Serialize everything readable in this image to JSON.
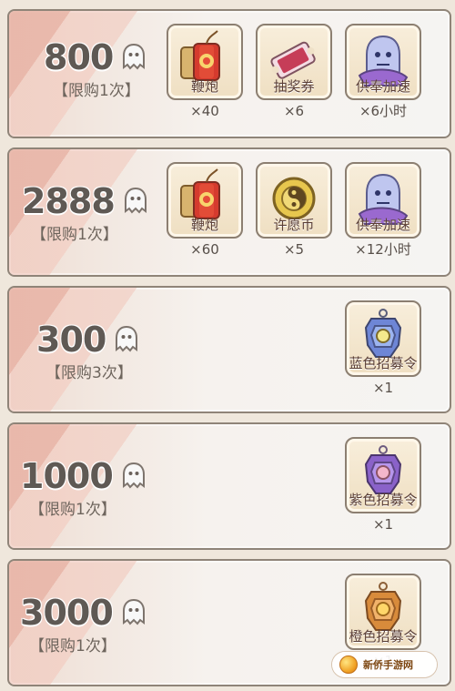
{
  "packages": [
    {
      "price": "800",
      "limit": "【限购1次】",
      "items": [
        {
          "label": "鞭炮",
          "qty": "×40",
          "icon": "firecracker-icon"
        },
        {
          "label": "抽奖券",
          "qty": "×6",
          "icon": "lottery-ticket-icon"
        },
        {
          "label": "供奉加速",
          "qty": "×6小时",
          "icon": "offering-boost-icon"
        }
      ]
    },
    {
      "price": "2888",
      "limit": "【限购1次】",
      "items": [
        {
          "label": "鞭炮",
          "qty": "×60",
          "icon": "firecracker-icon"
        },
        {
          "label": "许愿币",
          "qty": "×5",
          "icon": "wish-coin-icon"
        },
        {
          "label": "供奉加速",
          "qty": "×12小时",
          "icon": "offering-boost-icon"
        }
      ]
    },
    {
      "price": "300",
      "limit": "【限购3次】",
      "items": [
        {
          "label": "蓝色招募令",
          "qty": "×1",
          "icon": "blue-recruit-token-icon"
        }
      ]
    },
    {
      "price": "1000",
      "limit": "【限购1次】",
      "items": [
        {
          "label": "紫色招募令",
          "qty": "×1",
          "icon": "purple-recruit-token-icon"
        }
      ]
    },
    {
      "price": "3000",
      "limit": "【限购1次】",
      "items": [
        {
          "label": "橙色招募令",
          "qty": "×1",
          "icon": "orange-recruit-token-icon"
        }
      ]
    }
  ],
  "watermark": "新侨手游网",
  "colors": {
    "panel_border": "#8f8478",
    "price_text": "#5f5954",
    "item_frame": "#8c7f71",
    "item_fill": "#f8eedb"
  }
}
